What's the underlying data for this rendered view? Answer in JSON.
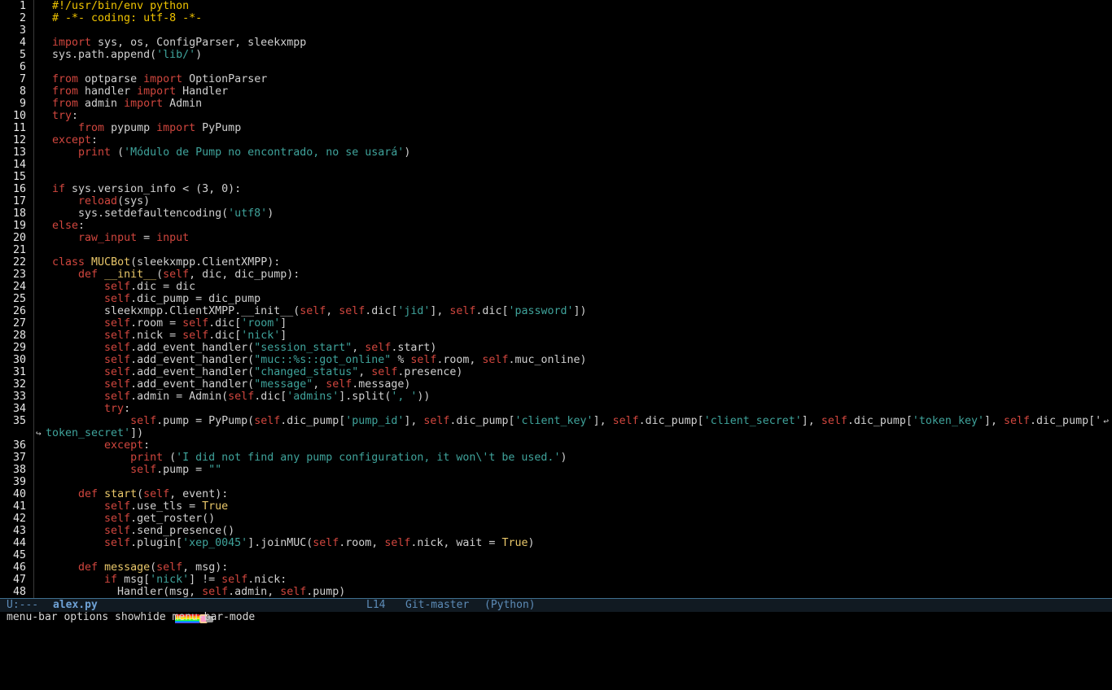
{
  "editor": {
    "lines": [
      {
        "n": "1",
        "t": [
          [
            "#!/usr/bin/env python",
            "cm"
          ]
        ]
      },
      {
        "n": "2",
        "t": [
          [
            "# -*- coding: utf-8 -*-",
            "cm"
          ]
        ]
      },
      {
        "n": "3",
        "t": []
      },
      {
        "n": "4",
        "t": [
          [
            "import",
            "kw"
          ],
          [
            " sys, os, ConfigParser, sleekxmpp",
            ""
          ]
        ]
      },
      {
        "n": "5",
        "t": [
          [
            "sys.path.append(",
            ""
          ],
          [
            "'lib/'",
            "str"
          ],
          [
            ")",
            ""
          ]
        ]
      },
      {
        "n": "6",
        "t": []
      },
      {
        "n": "7",
        "t": [
          [
            "from",
            "kw"
          ],
          [
            " optparse ",
            ""
          ],
          [
            "import",
            "kw"
          ],
          [
            " OptionParser",
            ""
          ]
        ]
      },
      {
        "n": "8",
        "t": [
          [
            "from",
            "kw"
          ],
          [
            " handler ",
            ""
          ],
          [
            "import",
            "kw"
          ],
          [
            " Handler",
            ""
          ]
        ]
      },
      {
        "n": "9",
        "t": [
          [
            "from",
            "kw"
          ],
          [
            " admin ",
            ""
          ],
          [
            "import",
            "kw"
          ],
          [
            " Admin",
            ""
          ]
        ]
      },
      {
        "n": "10",
        "t": [
          [
            "try",
            "kw"
          ],
          [
            ":",
            ""
          ]
        ]
      },
      {
        "n": "11",
        "t": [
          [
            "    ",
            ""
          ],
          [
            "from",
            "kw"
          ],
          [
            " pypump ",
            ""
          ],
          [
            "import",
            "kw"
          ],
          [
            " PyPump",
            ""
          ]
        ]
      },
      {
        "n": "12",
        "t": [
          [
            "except",
            "kw"
          ],
          [
            ":",
            ""
          ]
        ]
      },
      {
        "n": "13",
        "t": [
          [
            "    ",
            ""
          ],
          [
            "print",
            "kw"
          ],
          [
            " (",
            ""
          ],
          [
            "'Módulo de Pump no encontrado, no se usará'",
            "str"
          ],
          [
            ")",
            ""
          ]
        ]
      },
      {
        "n": "14",
        "t": []
      },
      {
        "n": "15",
        "t": []
      },
      {
        "n": "16",
        "t": [
          [
            "if",
            "kw"
          ],
          [
            " sys.version_info < (3, 0):",
            ""
          ]
        ]
      },
      {
        "n": "17",
        "t": [
          [
            "    ",
            ""
          ],
          [
            "reload",
            "bi"
          ],
          [
            "(sys)",
            ""
          ]
        ]
      },
      {
        "n": "18",
        "t": [
          [
            "    sys.setdefaultencoding(",
            ""
          ],
          [
            "'utf8'",
            "str"
          ],
          [
            ")",
            ""
          ]
        ]
      },
      {
        "n": "19",
        "t": [
          [
            "else",
            "kw"
          ],
          [
            ":",
            ""
          ]
        ]
      },
      {
        "n": "20",
        "t": [
          [
            "    ",
            ""
          ],
          [
            "raw_input",
            "bi"
          ],
          [
            " = ",
            ""
          ],
          [
            "input",
            "bi"
          ]
        ]
      },
      {
        "n": "21",
        "t": []
      },
      {
        "n": "22",
        "t": [
          [
            "class",
            "kw"
          ],
          [
            " ",
            ""
          ],
          [
            "MUCBot",
            "fn"
          ],
          [
            "(sleekxmpp.ClientXMPP):",
            ""
          ]
        ]
      },
      {
        "n": "23",
        "t": [
          [
            "    ",
            ""
          ],
          [
            "def",
            "kw"
          ],
          [
            " ",
            ""
          ],
          [
            "__init__",
            "fn"
          ],
          [
            "(",
            ""
          ],
          [
            "self",
            "sf"
          ],
          [
            ", dic, dic_pump):",
            ""
          ]
        ]
      },
      {
        "n": "24",
        "t": [
          [
            "        ",
            ""
          ],
          [
            "self",
            "sf"
          ],
          [
            ".dic = dic",
            ""
          ]
        ]
      },
      {
        "n": "25",
        "t": [
          [
            "        ",
            ""
          ],
          [
            "self",
            "sf"
          ],
          [
            ".dic_pump = dic_pump",
            ""
          ]
        ]
      },
      {
        "n": "26",
        "t": [
          [
            "        sleekxmpp.ClientXMPP.__init__(",
            ""
          ],
          [
            "self",
            "sf"
          ],
          [
            ", ",
            ""
          ],
          [
            "self",
            "sf"
          ],
          [
            ".dic[",
            ""
          ],
          [
            "'jid'",
            "str"
          ],
          [
            "], ",
            ""
          ],
          [
            "self",
            "sf"
          ],
          [
            ".dic[",
            ""
          ],
          [
            "'password'",
            "str"
          ],
          [
            "])",
            ""
          ]
        ]
      },
      {
        "n": "27",
        "t": [
          [
            "        ",
            ""
          ],
          [
            "self",
            "sf"
          ],
          [
            ".room = ",
            ""
          ],
          [
            "self",
            "sf"
          ],
          [
            ".dic[",
            ""
          ],
          [
            "'room'",
            "str"
          ],
          [
            "]",
            ""
          ]
        ]
      },
      {
        "n": "28",
        "t": [
          [
            "        ",
            ""
          ],
          [
            "self",
            "sf"
          ],
          [
            ".nick = ",
            ""
          ],
          [
            "self",
            "sf"
          ],
          [
            ".dic[",
            ""
          ],
          [
            "'nick'",
            "str"
          ],
          [
            "]",
            ""
          ]
        ]
      },
      {
        "n": "29",
        "t": [
          [
            "        ",
            ""
          ],
          [
            "self",
            "sf"
          ],
          [
            ".add_event_handler(",
            ""
          ],
          [
            "\"session_start\"",
            "str"
          ],
          [
            ", ",
            ""
          ],
          [
            "self",
            "sf"
          ],
          [
            ".start)",
            ""
          ]
        ]
      },
      {
        "n": "30",
        "t": [
          [
            "        ",
            ""
          ],
          [
            "self",
            "sf"
          ],
          [
            ".add_event_handler(",
            ""
          ],
          [
            "\"muc::%s::got_online\"",
            "str"
          ],
          [
            " % ",
            ""
          ],
          [
            "self",
            "sf"
          ],
          [
            ".room, ",
            ""
          ],
          [
            "self",
            "sf"
          ],
          [
            ".muc_online)",
            ""
          ]
        ]
      },
      {
        "n": "31",
        "t": [
          [
            "        ",
            ""
          ],
          [
            "self",
            "sf"
          ],
          [
            ".add_event_handler(",
            ""
          ],
          [
            "\"changed_status\"",
            "str"
          ],
          [
            ", ",
            ""
          ],
          [
            "self",
            "sf"
          ],
          [
            ".presence)",
            ""
          ]
        ]
      },
      {
        "n": "32",
        "t": [
          [
            "        ",
            ""
          ],
          [
            "self",
            "sf"
          ],
          [
            ".add_event_handler(",
            ""
          ],
          [
            "\"message\"",
            "str"
          ],
          [
            ", ",
            ""
          ],
          [
            "self",
            "sf"
          ],
          [
            ".message)",
            ""
          ]
        ]
      },
      {
        "n": "33",
        "t": [
          [
            "        ",
            ""
          ],
          [
            "self",
            "sf"
          ],
          [
            ".admin = Admin(",
            ""
          ],
          [
            "self",
            "sf"
          ],
          [
            ".dic[",
            ""
          ],
          [
            "'admins'",
            "str"
          ],
          [
            "].split(",
            ""
          ],
          [
            "', '",
            "str"
          ],
          [
            "))",
            ""
          ]
        ]
      },
      {
        "n": "34",
        "t": [
          [
            "        ",
            ""
          ],
          [
            "try",
            "kw"
          ],
          [
            ":",
            ""
          ]
        ]
      },
      {
        "n": "35",
        "t": [
          [
            "            ",
            ""
          ],
          [
            "self",
            "sf"
          ],
          [
            ".pump = PyPump(",
            ""
          ],
          [
            "self",
            "sf"
          ],
          [
            ".dic_pump[",
            ""
          ],
          [
            "'pump_id'",
            "str"
          ],
          [
            "], ",
            ""
          ],
          [
            "self",
            "sf"
          ],
          [
            ".dic_pump[",
            ""
          ],
          [
            "'client_key'",
            "str"
          ],
          [
            "], ",
            ""
          ],
          [
            "self",
            "sf"
          ],
          [
            ".dic_pump[",
            ""
          ],
          [
            "'client_secret'",
            "str"
          ],
          [
            "], ",
            ""
          ],
          [
            "self",
            "sf"
          ],
          [
            ".dic_pump[",
            ""
          ],
          [
            "'token_key'",
            "str"
          ],
          [
            "], ",
            ""
          ],
          [
            "self",
            "sf"
          ],
          [
            ".dic_pump['",
            ""
          ]
        ],
        "wrap": true
      },
      {
        "n": "",
        "cont": true,
        "t": [
          [
            "token_secret'",
            "str"
          ],
          [
            "])",
            ""
          ]
        ]
      },
      {
        "n": "36",
        "t": [
          [
            "        ",
            ""
          ],
          [
            "except",
            "kw"
          ],
          [
            ":",
            ""
          ]
        ]
      },
      {
        "n": "37",
        "t": [
          [
            "            ",
            ""
          ],
          [
            "print",
            "kw"
          ],
          [
            " (",
            ""
          ],
          [
            "'I did not find any pump configuration, it won\\'t be used.'",
            "str"
          ],
          [
            ")",
            ""
          ]
        ]
      },
      {
        "n": "38",
        "t": [
          [
            "            ",
            ""
          ],
          [
            "self",
            "sf"
          ],
          [
            ".pump = ",
            ""
          ],
          [
            "\"\"",
            "str"
          ]
        ]
      },
      {
        "n": "39",
        "t": []
      },
      {
        "n": "40",
        "t": [
          [
            "    ",
            ""
          ],
          [
            "def",
            "kw"
          ],
          [
            " ",
            ""
          ],
          [
            "start",
            "fn"
          ],
          [
            "(",
            ""
          ],
          [
            "self",
            "sf"
          ],
          [
            ", event):",
            ""
          ]
        ]
      },
      {
        "n": "41",
        "t": [
          [
            "        ",
            ""
          ],
          [
            "self",
            "sf"
          ],
          [
            ".use_tls = ",
            ""
          ],
          [
            "True",
            "cn"
          ]
        ]
      },
      {
        "n": "42",
        "t": [
          [
            "        ",
            ""
          ],
          [
            "self",
            "sf"
          ],
          [
            ".get_roster()",
            ""
          ]
        ]
      },
      {
        "n": "43",
        "t": [
          [
            "        ",
            ""
          ],
          [
            "self",
            "sf"
          ],
          [
            ".send_presence()",
            ""
          ]
        ]
      },
      {
        "n": "44",
        "t": [
          [
            "        ",
            ""
          ],
          [
            "self",
            "sf"
          ],
          [
            ".plugin[",
            ""
          ],
          [
            "'xep_0045'",
            "str"
          ],
          [
            "].joinMUC(",
            ""
          ],
          [
            "self",
            "sf"
          ],
          [
            ".room, ",
            ""
          ],
          [
            "self",
            "sf"
          ],
          [
            ".nick, wait = ",
            ""
          ],
          [
            "True",
            "cn"
          ],
          [
            ")",
            ""
          ]
        ]
      },
      {
        "n": "45",
        "t": []
      },
      {
        "n": "46",
        "t": [
          [
            "    ",
            ""
          ],
          [
            "def",
            "kw"
          ],
          [
            " ",
            ""
          ],
          [
            "message",
            "fn"
          ],
          [
            "(",
            ""
          ],
          [
            "self",
            "sf"
          ],
          [
            ", msg):",
            ""
          ]
        ]
      },
      {
        "n": "47",
        "t": [
          [
            "        ",
            ""
          ],
          [
            "if",
            "kw"
          ],
          [
            " msg[",
            ""
          ],
          [
            "'nick'",
            "str"
          ],
          [
            "] != ",
            ""
          ],
          [
            "self",
            "sf"
          ],
          [
            ".nick:",
            ""
          ]
        ]
      },
      {
        "n": "48",
        "t": [
          [
            "          Handler(msg, ",
            ""
          ],
          [
            "self",
            "sf"
          ],
          [
            ".admin, ",
            ""
          ],
          [
            "self",
            "sf"
          ],
          [
            ".pump)",
            ""
          ]
        ]
      }
    ]
  },
  "modeline": {
    "state": "U:---",
    "filename": "alex.py",
    "line": "L14",
    "vcs": "Git-master",
    "mode": "(Python)"
  },
  "minibuffer": {
    "text": "menu-bar options showhide menu-bar-mode"
  },
  "icons": {
    "wrap": "wrap-arrow-icon",
    "nyan": "nyan-cat-icon"
  }
}
